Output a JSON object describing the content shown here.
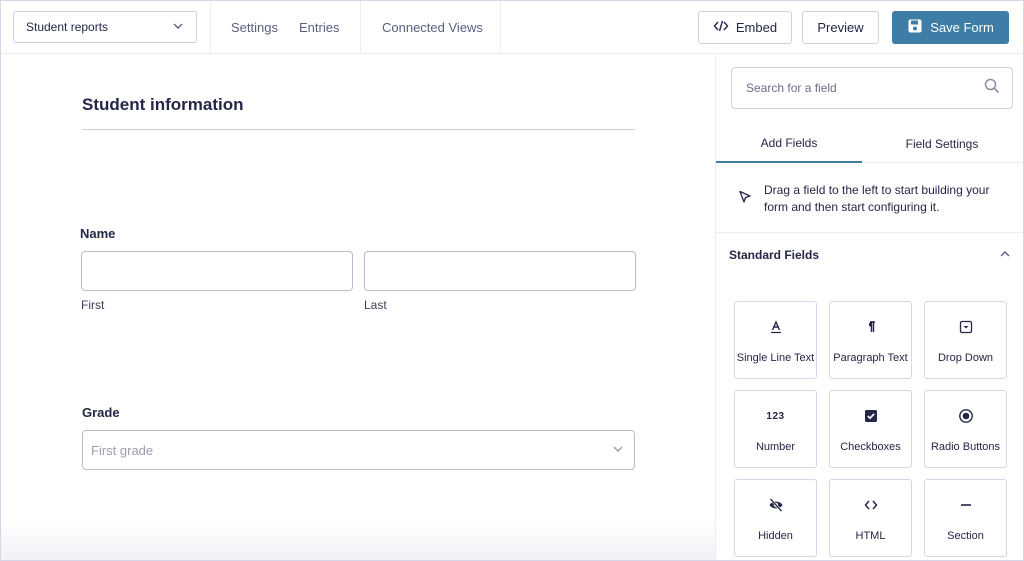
{
  "header": {
    "form_name": "Student reports",
    "nav": [
      "Settings",
      "Entries",
      "Connected Views"
    ],
    "embed_label": "Embed",
    "preview_label": "Preview",
    "save_label": "Save Form"
  },
  "canvas": {
    "title": "Student information",
    "name_field": {
      "label": "Name",
      "first_label": "First",
      "last_label": "Last"
    },
    "grade_field": {
      "label": "Grade",
      "selected": "First grade"
    }
  },
  "sidebar": {
    "search_placeholder": "Search for a field",
    "tabs": [
      "Add Fields",
      "Field Settings"
    ],
    "hint": "Drag a field to the left to start building your form and then start configuring it.",
    "section_title": "Standard Fields",
    "fields": [
      {
        "label": "Single Line Text",
        "icon": "single-line-text-icon"
      },
      {
        "label": "Paragraph Text",
        "icon": "paragraph-icon"
      },
      {
        "label": "Drop Down",
        "icon": "dropdown-icon"
      },
      {
        "label": "Number",
        "icon": "number-icon",
        "glyph": "123"
      },
      {
        "label": "Checkboxes",
        "icon": "checkbox-icon"
      },
      {
        "label": "Radio Buttons",
        "icon": "radio-icon"
      },
      {
        "label": "Hidden",
        "icon": "eye-off-icon"
      },
      {
        "label": "HTML",
        "icon": "code-icon"
      },
      {
        "label": "Section",
        "icon": "section-icon"
      }
    ]
  },
  "colors": {
    "primary": "#3e7da6",
    "text": "#242748",
    "border": "#cfd1e6"
  }
}
